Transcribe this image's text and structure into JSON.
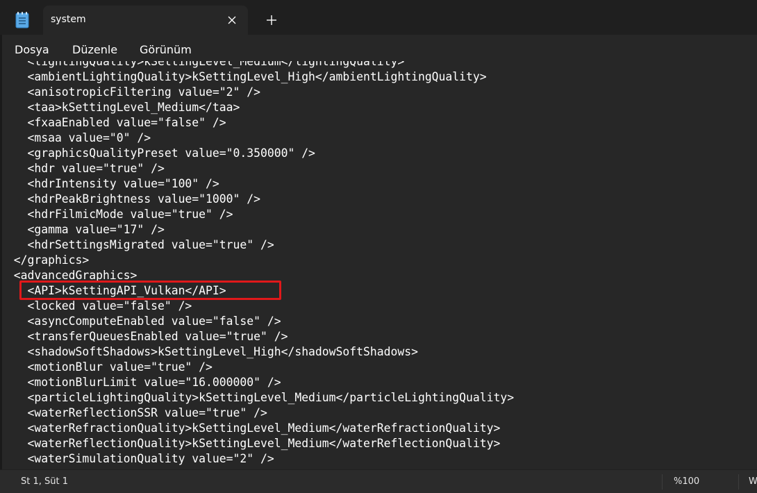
{
  "tab": {
    "title": "system",
    "close_icon": "close-icon",
    "new_tab_icon": "plus-icon"
  },
  "menu": {
    "items": [
      "Dosya",
      "Düzenle",
      "Görünüm"
    ]
  },
  "editor": {
    "lines": [
      "    <lightingQuality>kSettingLevel_Medium</lightingQuality>",
      "    <ambientLightingQuality>kSettingLevel_High</ambientLightingQuality>",
      "    <anisotropicFiltering value=\"2\" />",
      "    <taa>kSettingLevel_Medium</taa>",
      "    <fxaaEnabled value=\"false\" />",
      "    <msaa value=\"0\" />",
      "    <graphicsQualityPreset value=\"0.350000\" />",
      "    <hdr value=\"true\" />",
      "    <hdrIntensity value=\"100\" />",
      "    <hdrPeakBrightness value=\"1000\" />",
      "    <hdrFilmicMode value=\"true\" />",
      "    <gamma value=\"17\" />",
      "    <hdrSettingsMigrated value=\"true\" />",
      "  </graphics>",
      "  <advancedGraphics>",
      "    <API>kSettingAPI_Vulkan</API>",
      "    <locked value=\"false\" />",
      "    <asyncComputeEnabled value=\"false\" />",
      "    <transferQueuesEnabled value=\"true\" />",
      "    <shadowSoftShadows>kSettingLevel_High</shadowSoftShadows>",
      "    <motionBlur value=\"true\" />",
      "    <motionBlurLimit value=\"16.000000\" />",
      "    <particleLightingQuality>kSettingLevel_Medium</particleLightingQuality>",
      "    <waterReflectionSSR value=\"true\" />",
      "    <waterRefractionQuality>kSettingLevel_Medium</waterRefractionQuality>",
      "    <waterReflectionQuality>kSettingLevel_Medium</waterReflectionQuality>",
      "    <waterSimulationQuality value=\"2\" />"
    ],
    "highlight_color": "#e0181a"
  },
  "status": {
    "position": "St 1, Süt 1",
    "zoom": "%100",
    "extra": "W"
  },
  "colors": {
    "background": "#272727",
    "tabstrip": "#1f1f1f",
    "text": "#ffffff",
    "notepad_icon": "#5aa9e6"
  }
}
